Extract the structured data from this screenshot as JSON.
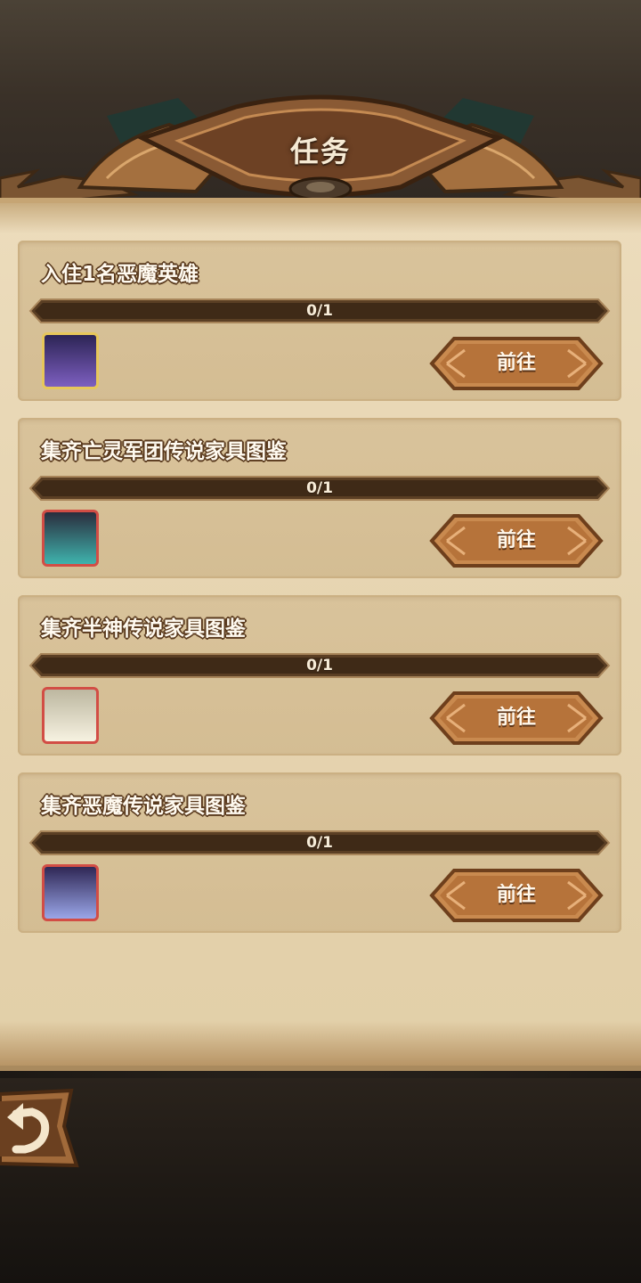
{
  "header": {
    "title": "任务"
  },
  "tasks": [
    {
      "title": "入住1名恶魔英雄",
      "progress_text": "0/1",
      "progress": 0,
      "reward_icon": "demon-hero-icon",
      "reward_frame": "#e7c75a",
      "reward_top": "#2c2455",
      "reward_bottom": "#7d5fc0",
      "button_label": "前往"
    },
    {
      "title": "集齐亡灵军团传说家具图鉴",
      "progress_text": "0/1",
      "progress": 0,
      "reward_icon": "undead-furniture-icon",
      "reward_frame": "#d24d45",
      "reward_top": "#2a2d3d",
      "reward_bottom": "#3fb3ad",
      "button_label": "前往"
    },
    {
      "title": "集齐半神传说家具图鉴",
      "progress_text": "0/1",
      "progress": 0,
      "reward_icon": "demigod-furniture-icon",
      "reward_frame": "#d24d45",
      "reward_top": "#bdb7a0",
      "reward_bottom": "#f6f2e1",
      "button_label": "前往"
    },
    {
      "title": "集齐恶魔传说家具图鉴",
      "progress_text": "0/1",
      "progress": 0,
      "reward_icon": "demon-furniture-icon",
      "reward_frame": "#d24d45",
      "reward_top": "#2f2755",
      "reward_bottom": "#9aa6e8",
      "button_label": "前往"
    }
  ],
  "back_button": {
    "icon": "back-arrow-icon"
  }
}
